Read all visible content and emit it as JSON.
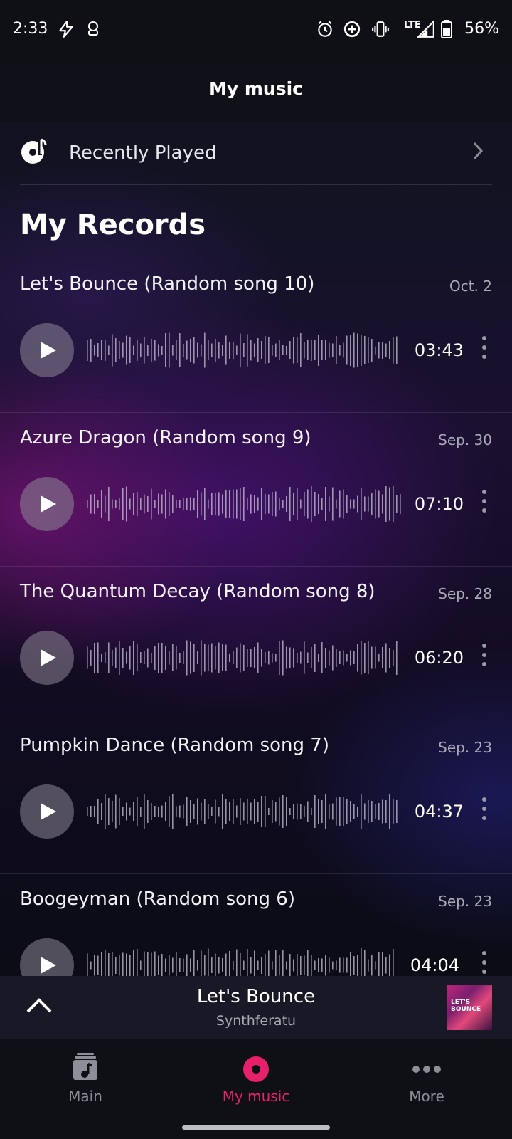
{
  "status": {
    "time": "2:33",
    "battery": "56%",
    "network": "LTE"
  },
  "appbar": {
    "title": "My music"
  },
  "recent": {
    "label": "Recently Played"
  },
  "section": {
    "title": "My Records"
  },
  "records": [
    {
      "title": "Let's Bounce (Random song 10)",
      "date": "Oct. 2",
      "duration": "03:43"
    },
    {
      "title": "Azure Dragon (Random song 9)",
      "date": "Sep. 30",
      "duration": "07:10"
    },
    {
      "title": "The Quantum Decay (Random song 8)",
      "date": "Sep. 28",
      "duration": "06:20"
    },
    {
      "title": "Pumpkin Dance (Random song 7)",
      "date": "Sep. 23",
      "duration": "04:37"
    },
    {
      "title": "Boogeyman (Random song 6)",
      "date": "Sep. 23",
      "duration": "04:04"
    }
  ],
  "miniplayer": {
    "title": "Let's Bounce",
    "artist": "Synthferatu",
    "art_text_1": "LET'S",
    "art_text_2": "BOUNCE"
  },
  "nav": {
    "items": [
      {
        "label": "Main"
      },
      {
        "label": "My music"
      },
      {
        "label": "More"
      }
    ]
  },
  "colors": {
    "accent": "#e8206c"
  }
}
